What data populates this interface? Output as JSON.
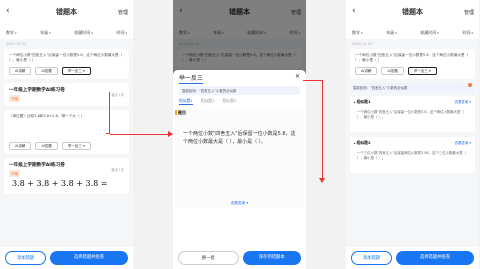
{
  "app": {
    "title": "错题本",
    "manage": "管理"
  },
  "filters": [
    "数学",
    "年级",
    "收藏时间",
    "时间"
  ],
  "date": "2023.11.23",
  "panel1": {
    "card1": {
      "q": "一个两位小数\"四舍五入\"后保留一位小数是5.8，这个两位小数最大是（ ），最小是（ ）",
      "btn1": "AI讲解",
      "btn2": "AI答题",
      "btn3": "举一反三 ▾"
    },
    "card2": {
      "title": "一年级上学期数学AI练习卷",
      "tag": "不懂",
      "meta": "被点 1次"
    },
    "card3": {
      "q": "（单位题）比较3.8和3.8+0.8，哪一个大（ ）",
      "btn1": "AI讲解",
      "btn2": "AI答题",
      "btn3": "举一反三 ▾"
    },
    "card4": {
      "title": "一年级上学期数学AI练习卷",
      "tag": "不懂",
      "meta": "被点 1次"
    },
    "math": "3.8 + 3.8 + 3.8 + 3.8 ="
  },
  "panel2": {
    "sheet_title": "举一反三",
    "hint": "智能检测：“四舍五入”小数的近似数",
    "tabs": [
      "相似题1",
      "相似题2",
      "相似题3"
    ],
    "q_label": "题目",
    "q_text": "一个两位小数\"四舍五入\"后保留一位小数是5.8，这个两位小数最大是（ ），最小是（ ）。",
    "more": "查看答案 ▾",
    "btn_left": "换一批",
    "btn_right": "保存到错题本"
  },
  "panel3": {
    "sim1": {
      "h": "相似题1",
      "v": "查看答案 ▾",
      "t": "一个两位小数\"四舍五入\"后保留一位小数是5.8，这个两位小数最大是（ ），最小是（ ）。"
    },
    "sim2": {
      "h": "相似题2",
      "v": "查看答案 ▾",
      "t": "一个三位小数\"四舍五入\"后保留两位小数是3.88，这个三位小数最大是（ ），最小是（ ）。"
    }
  },
  "bottom": {
    "add": "添加错题",
    "gen": "选择错题并组卷"
  }
}
